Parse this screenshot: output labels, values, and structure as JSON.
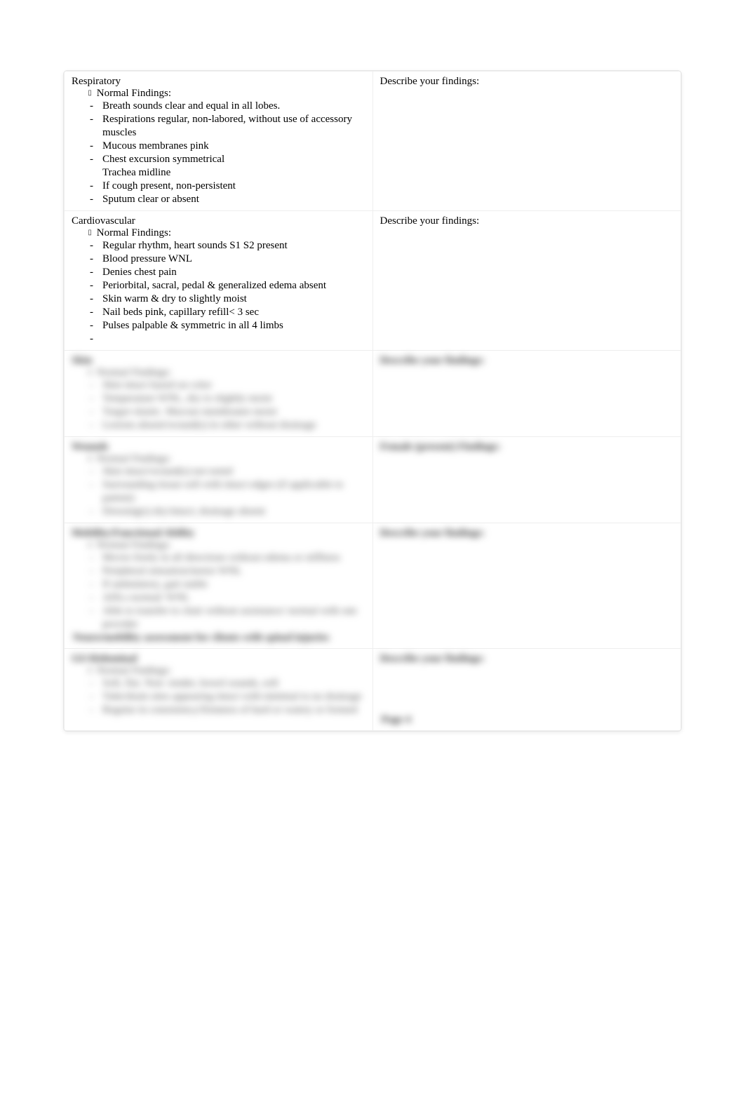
{
  "labels": {
    "normal_findings": "Normal  Findings:",
    "describe": "Describe your findings:",
    "describe_female": "Female (present) Findings:",
    "pager": "Page 4"
  },
  "sections": [
    {
      "heading": "Respiratory",
      "right_label": "describe",
      "blurred": false,
      "items": [
        {
          "t": "Breath sounds clear and equal in all lobes."
        },
        {
          "t": "Respirations regular, non-labored, without use of accessory muscles"
        },
        {
          "t": "Mucous membranes pink"
        },
        {
          "t": "Chest excursion symmetrical"
        },
        {
          "t": "Trachea  midline",
          "no_dash": true
        },
        {
          "t": "If cough present, non-persistent"
        },
        {
          "t": "Sputum clear or absent"
        }
      ]
    },
    {
      "heading": "Cardiovascular",
      "right_label": "describe",
      "blurred": false,
      "items": [
        {
          "t": "Regular rhythm, heart sounds S1 S2 present"
        },
        {
          "t": "Blood pressure WNL"
        },
        {
          "t": "Denies chest pain"
        },
        {
          "t": "Periorbital, sacral, pedal & generalized edema  absent"
        },
        {
          "t": "Skin warm & dry to slightly moist"
        },
        {
          "t": "Nail beds pink, capillary refill< 3 sec"
        },
        {
          "t": "Pulses palpable & symmetric in all 4 limbs"
        }
      ]
    },
    {
      "heading": "Skin",
      "right_label": "describe",
      "blurred": true,
      "items": [
        {
          "t": "Skin intact based on color"
        },
        {
          "t": "Temperature WNL, dry to slightly moist"
        },
        {
          "t": "Turgor elastic. Mucous membranes moist"
        },
        {
          "t": "Lesions absent/wound(s) in other without drainage"
        }
      ]
    },
    {
      "heading": "Wounds",
      "right_label": "describe_female",
      "blurred": true,
      "items": [
        {
          "t": "Skin intact/wound(s) not noted"
        },
        {
          "t": "Surrounding tissue soft with intact edges (if applicable to patient)"
        },
        {
          "t": "Dressing(s) dry/intact; drainage absent"
        }
      ]
    },
    {
      "heading": "Mobility/Functional Ability",
      "right_label": "describe",
      "blurred": true,
      "extra_note": "Neuro/mobility assessment for clients with spinal injuries",
      "items": [
        {
          "t": "Moves freely in all directions without edema or stiffness"
        },
        {
          "t": "Peripheral sensation/motor WNL"
        },
        {
          "t": "If ambulatory, gait stable"
        },
        {
          "t": "ADLs normal/ WNL"
        },
        {
          "t": "Able to transfer to chair without assistance/ normal with one provider"
        }
      ]
    },
    {
      "heading": "GI/Abdominal",
      "right_label": "describe",
      "blurred": true,
      "items": [
        {
          "t": "Soft, flat. Non- tender,  bowel sounds, soft"
        },
        {
          "t": "Tube/drain sites appearing intact with minimal to no drainage"
        },
        {
          "t": "Regular in consistency/firmness of hard or watery or formed"
        }
      ]
    }
  ]
}
